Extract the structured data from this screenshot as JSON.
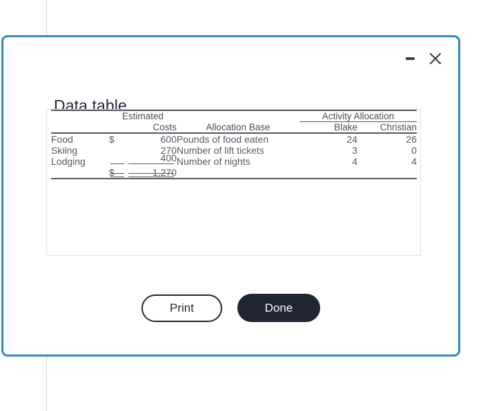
{
  "background": {
    "guide_line_color": "#d8d8d8"
  },
  "modal": {
    "title": "Data table",
    "border_color": "#2f8db8",
    "window_controls": {
      "minimize_label": "minimize",
      "close_label": "close"
    },
    "footer": {
      "print_label": "Print",
      "done_label": "Done",
      "done_bg": "#1f2533"
    }
  },
  "table": {
    "group_headers": {
      "estimated": "Estimated",
      "activity_allocation": "Activity Allocation"
    },
    "columns": [
      {
        "key": "item",
        "label": ""
      },
      {
        "key": "dollar",
        "label": ""
      },
      {
        "key": "costs",
        "label": "Costs"
      },
      {
        "key": "base",
        "label": "Allocation Base"
      },
      {
        "key": "blake",
        "label": "Blake"
      },
      {
        "key": "christian",
        "label": "Christian"
      }
    ],
    "rows": [
      {
        "item": "Food",
        "dollar": "$",
        "amount": "600",
        "base": "Pounds of food eaten",
        "blake": "24",
        "christian": "26"
      },
      {
        "item": "Skiing",
        "dollar": "",
        "amount": "270",
        "base": "Number of lift tickets",
        "blake": "3",
        "christian": "0"
      },
      {
        "item": "Lodging",
        "dollar": "",
        "amount": "400",
        "base": "Number of nights",
        "blake": "4",
        "christian": "4"
      }
    ],
    "total": {
      "item": "",
      "dollar": "$",
      "amount": "1,270",
      "base": "",
      "blake": "",
      "christian": ""
    }
  }
}
